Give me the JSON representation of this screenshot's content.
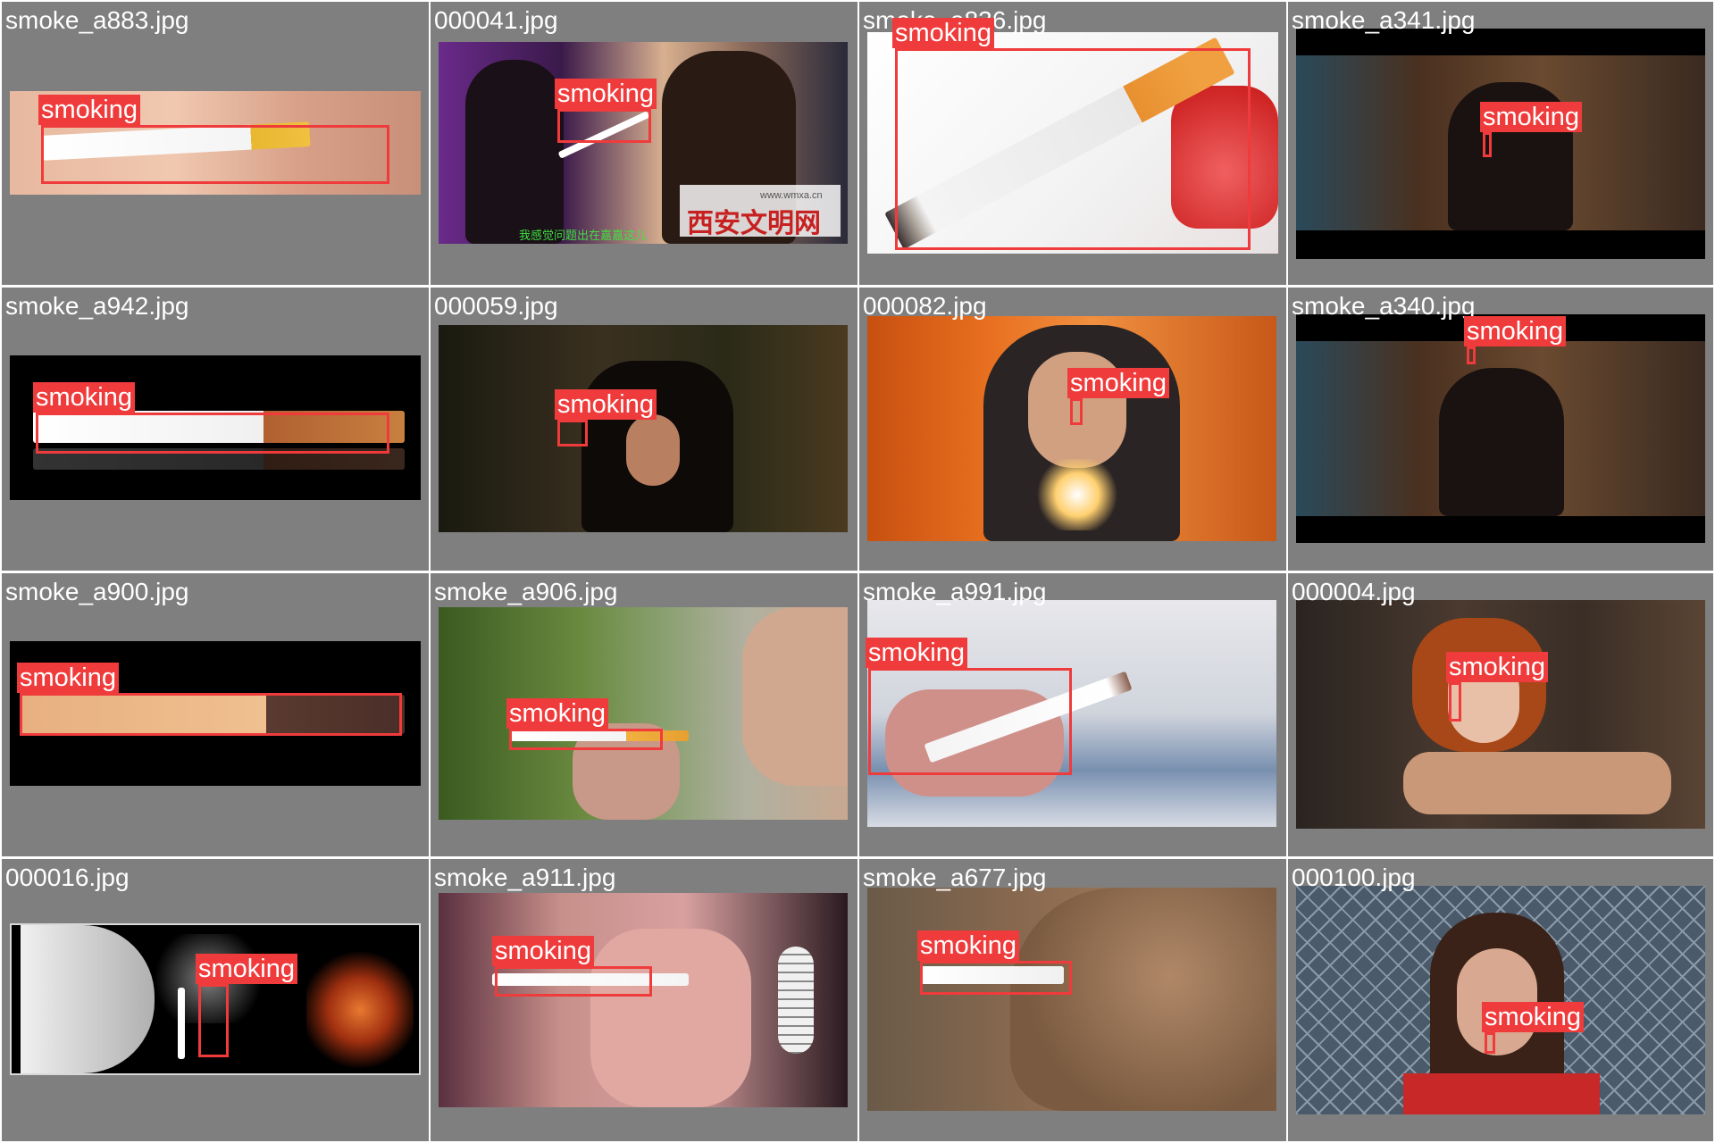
{
  "grid": {
    "detection_label": "smoking",
    "colors": {
      "cell_bg": "#7f7f7f",
      "box": "#ef3b3b",
      "label_text": "#ffffff"
    }
  },
  "cells": [
    {
      "filename": "smoke_a883.jpg",
      "label": "smoking"
    },
    {
      "filename": "000041.jpg",
      "label": "smoking",
      "watermark": "www.wmxa.cn",
      "caption": "我感觉问题出在嘉嘉这儿",
      "logo_text": "西安文明网"
    },
    {
      "filename": "smoke_a836.jpg",
      "label": "smoking"
    },
    {
      "filename": "smoke_a341.jpg",
      "label": "smoking"
    },
    {
      "filename": "smoke_a942.jpg",
      "label": "smoking"
    },
    {
      "filename": "000059.jpg",
      "label": "smoking"
    },
    {
      "filename": "000082.jpg",
      "label": "smoking"
    },
    {
      "filename": "smoke_a340.jpg",
      "label": "smoking"
    },
    {
      "filename": "smoke_a900.jpg",
      "label": "smoking"
    },
    {
      "filename": "smoke_a906.jpg",
      "label": "smoking"
    },
    {
      "filename": "smoke_a991.jpg",
      "label": "smoking"
    },
    {
      "filename": "000004.jpg",
      "label": "smoking"
    },
    {
      "filename": "000016.jpg",
      "label": "smoking"
    },
    {
      "filename": "smoke_a911.jpg",
      "label": "smoking"
    },
    {
      "filename": "smoke_a677.jpg",
      "label": "smoking"
    },
    {
      "filename": "000100.jpg",
      "label": "smoking"
    }
  ]
}
